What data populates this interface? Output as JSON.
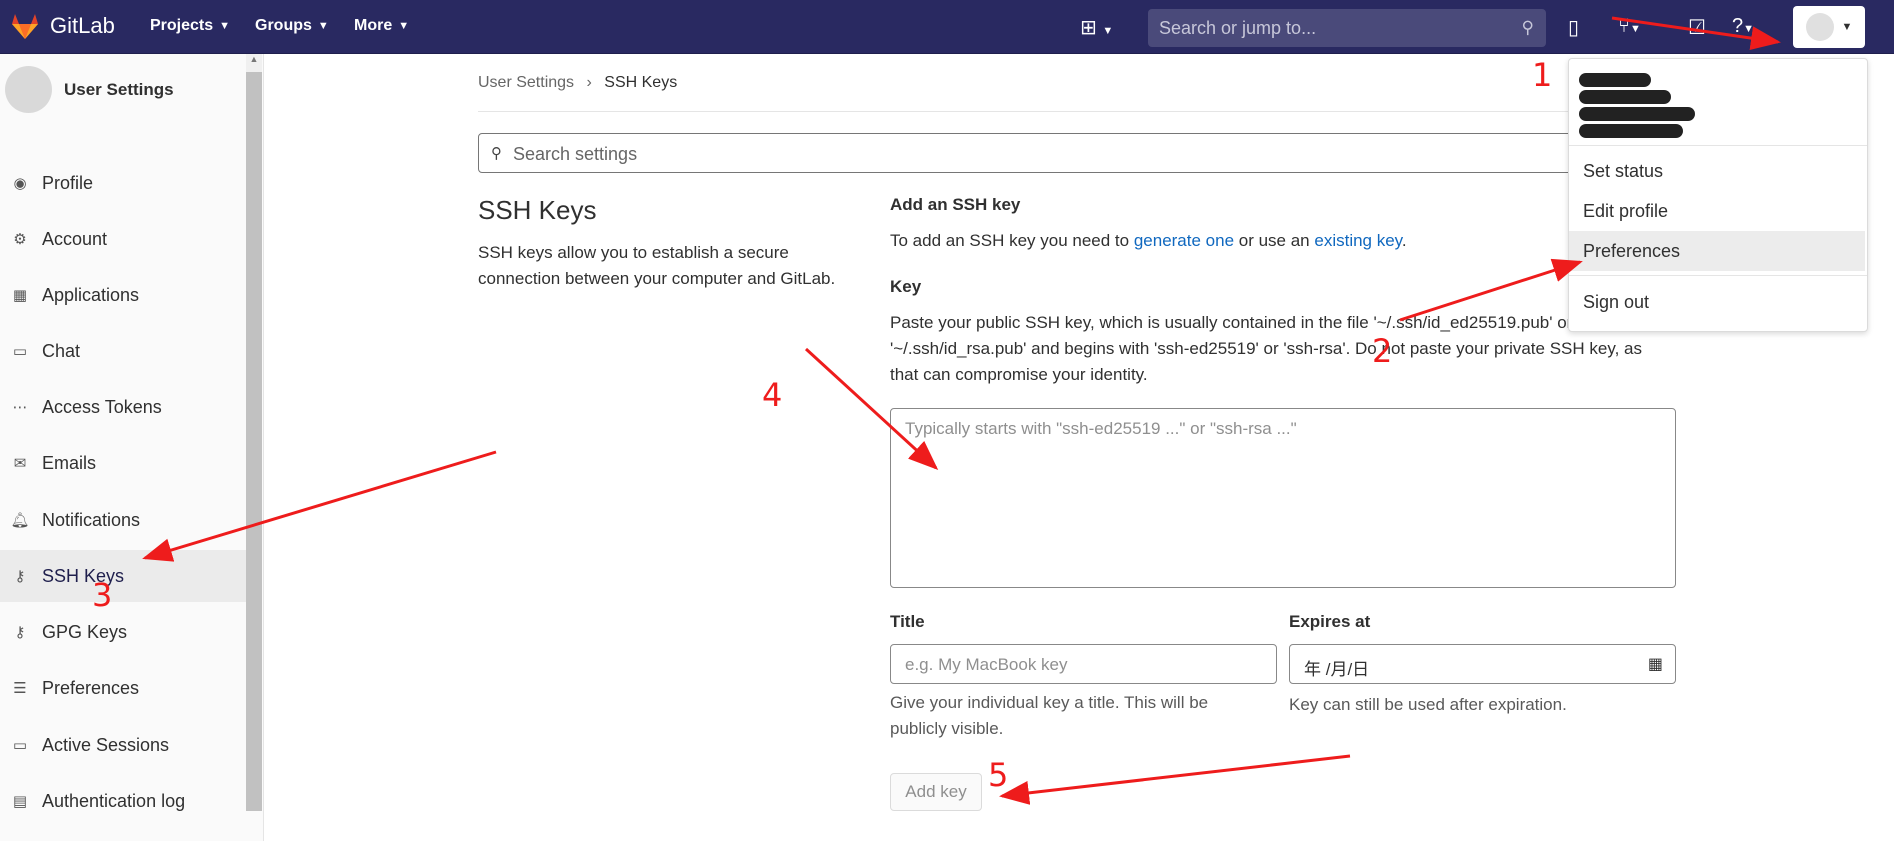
{
  "topbar": {
    "brand": "GitLab",
    "nav": [
      "Projects",
      "Groups",
      "More"
    ],
    "search_placeholder": "Search or jump to...",
    "icons": [
      "plus-square-icon",
      "issues-icon",
      "merge-request-icon",
      "todo-icon",
      "help-icon",
      "avatar-icon"
    ]
  },
  "sidebar": {
    "title": "User Settings",
    "items": [
      {
        "label": "Profile",
        "icon": "profile-icon"
      },
      {
        "label": "Account",
        "icon": "account-icon"
      },
      {
        "label": "Applications",
        "icon": "applications-icon"
      },
      {
        "label": "Chat",
        "icon": "chat-icon"
      },
      {
        "label": "Access Tokens",
        "icon": "token-icon"
      },
      {
        "label": "Emails",
        "icon": "mail-icon"
      },
      {
        "label": "Notifications",
        "icon": "bell-icon"
      },
      {
        "label": "SSH Keys",
        "icon": "key-icon"
      },
      {
        "label": "GPG Keys",
        "icon": "key-icon"
      },
      {
        "label": "Preferences",
        "icon": "preferences-icon"
      },
      {
        "label": "Active Sessions",
        "icon": "monitor-icon"
      },
      {
        "label": "Authentication log",
        "icon": "log-icon"
      }
    ]
  },
  "breadcrumb": {
    "parent": "User Settings",
    "separator": "›",
    "current": "SSH Keys"
  },
  "settings_search_placeholder": "Search settings",
  "section": {
    "title": "SSH Keys",
    "description": "SSH keys allow you to establish a secure connection between your computer and GitLab."
  },
  "form": {
    "heading": "Add an SSH key",
    "intro_before": "To add an SSH key you need to ",
    "intro_link1": "generate one",
    "intro_middle": " or use an ",
    "intro_link2": "existing key",
    "intro_after": ".",
    "key_label": "Key",
    "key_help_line1": "Paste your public SSH key, which is usually contained in the file '~/.ssh/id_ed25519.pub' or",
    "key_help_line2": "'~/.ssh/id_rsa.pub' and begins with 'ssh-ed25519' or 'ssh-rsa'. Do not paste your private SSH key, as",
    "key_help_line3": "that can compromise your identity.",
    "key_placeholder": "Typically starts with \"ssh-ed25519 ...\" or \"ssh-rsa ...\"",
    "title_label": "Title",
    "title_placeholder": "e.g. My MacBook key",
    "title_help": "Give your individual key a title. This will be publicly visible.",
    "expires_label": "Expires at",
    "expires_value": "年 /月/日",
    "expires_help": "Key can still be used after expiration.",
    "add_button": "Add key"
  },
  "dropdown": {
    "items": [
      "Set status",
      "Edit profile",
      "Preferences",
      "Sign out"
    ],
    "highlighted": "Preferences"
  },
  "annotations": {
    "n1": "1",
    "n2": "2",
    "n3": "3",
    "n4": "4",
    "n5": "5",
    "color": "#ee1c1c"
  },
  "colors": {
    "topbar": "#292961",
    "link": "#1068bf"
  }
}
